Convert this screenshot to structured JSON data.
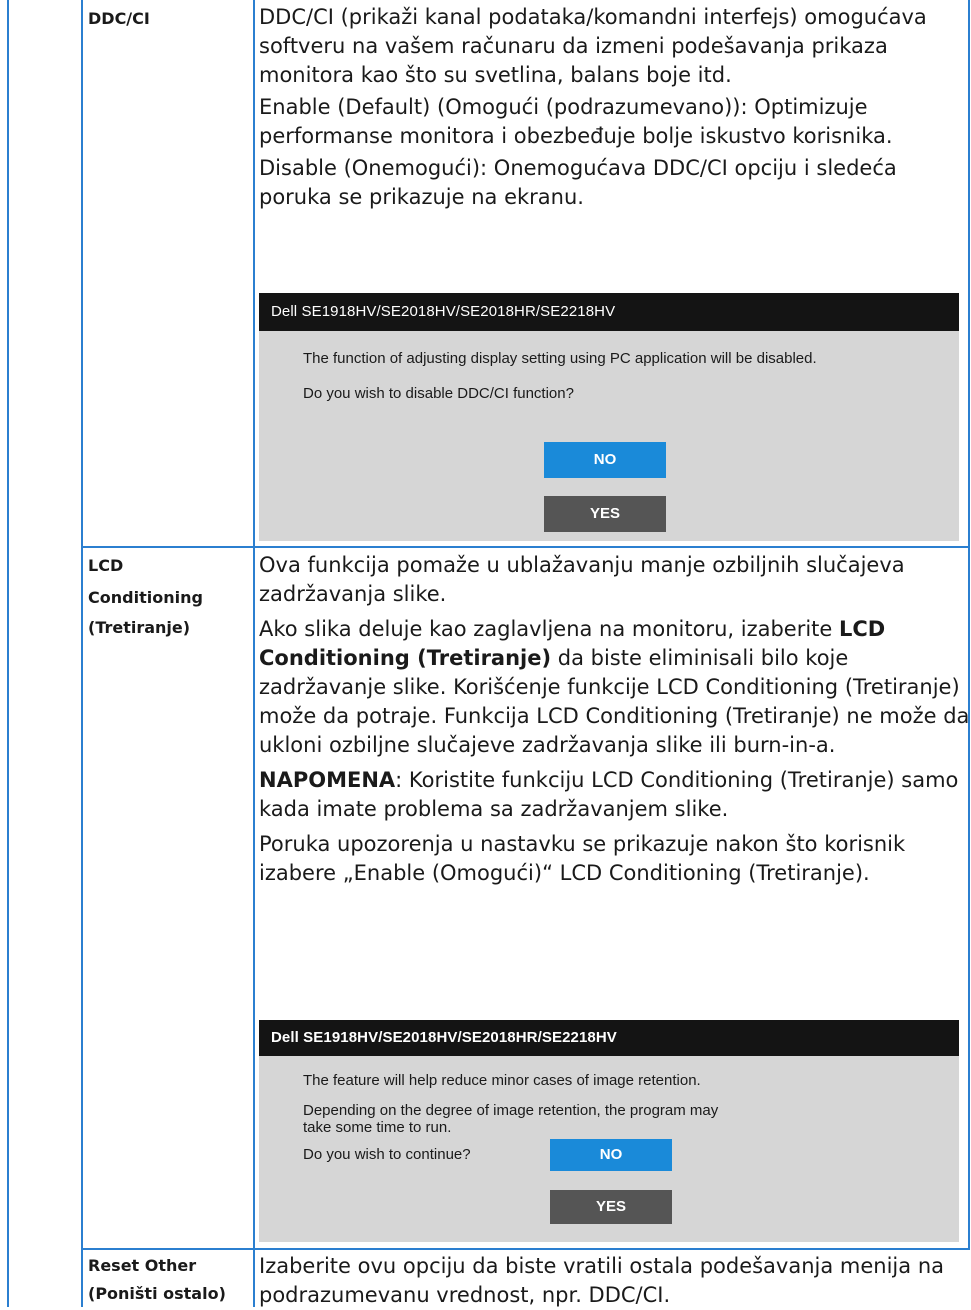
{
  "rows": [
    {
      "label": [
        "DDC/CI"
      ],
      "paragraphs": [
        "DDC/CI (prikaži kanal podataka/komandni interfejs) omogućava softveru na vašem računaru da izmeni podešavanja prikaza monitora kao što su svetlina, balans boje itd.",
        "Enable (Default) (Omogući (podrazumevano)): Optimizuje performanse monitora i obezbeđuje bolje iskustvo korisnika.",
        "Disable (Onemogući): Onemogućava DDC/CI opciju i sledeća poruka se prikazuje na ekranu."
      ],
      "dialog": {
        "title": "Dell SE1918HV/SE2018HV/SE2018HR/SE2218HV",
        "lines": [
          "The function of adjusting display setting using PC application will be disabled.",
          "Do you wish to disable DDC/CI function?"
        ],
        "no_label": "NO",
        "yes_label": "YES"
      }
    },
    {
      "label": [
        "LCD",
        "Conditioning",
        "(Tretiranje)"
      ],
      "paragraphs": [
        "Ova funkcija pomaže u ublažavanju manje ozbiljnih slučajeva zadržavanja slike.",
        {
          "before": "Ako slika deluje kao zaglavljena na monitoru, izaberite ",
          "bold": "LCD Conditioning (Tretiranje)",
          "after": " da biste eliminisali bilo koje zadržavanje slike. Korišćenje funkcije LCD Conditioning (Tretiranje) može da potraje. Funkcija LCD Conditioning (Tretiranje) ne može da ukloni ozbiljne slučajeve zadržavanja slike ili burn-in-a."
        },
        {
          "bold": "NAPOMENA",
          "after": ": Koristite funkciju LCD Conditioning (Tretiranje) samo kada imate problema sa zadržavanjem slike."
        },
        "Poruka upozorenja u nastavku se prikazuje nakon što korisnik izabere „Enable (Omogući)“ LCD Conditioning (Tretiranje)."
      ],
      "dialog": {
        "title": "Dell SE1918HV/SE2018HV/SE2018HR/SE2218HV",
        "lines": [
          "The feature will help reduce minor cases of image retention.",
          "Depending on the degree of image retention, the program may take some time to run.",
          "Do you wish to continue?"
        ],
        "no_label": "NO",
        "yes_label": "YES"
      }
    },
    {
      "label": [
        "Reset Other",
        "(Poništi ostalo)"
      ],
      "paragraphs": [
        "Izaberite ovu opciju da biste vratili ostala podešavanja menija na podrazumevanu vrednost, npr. DDC/CI."
      ]
    }
  ]
}
